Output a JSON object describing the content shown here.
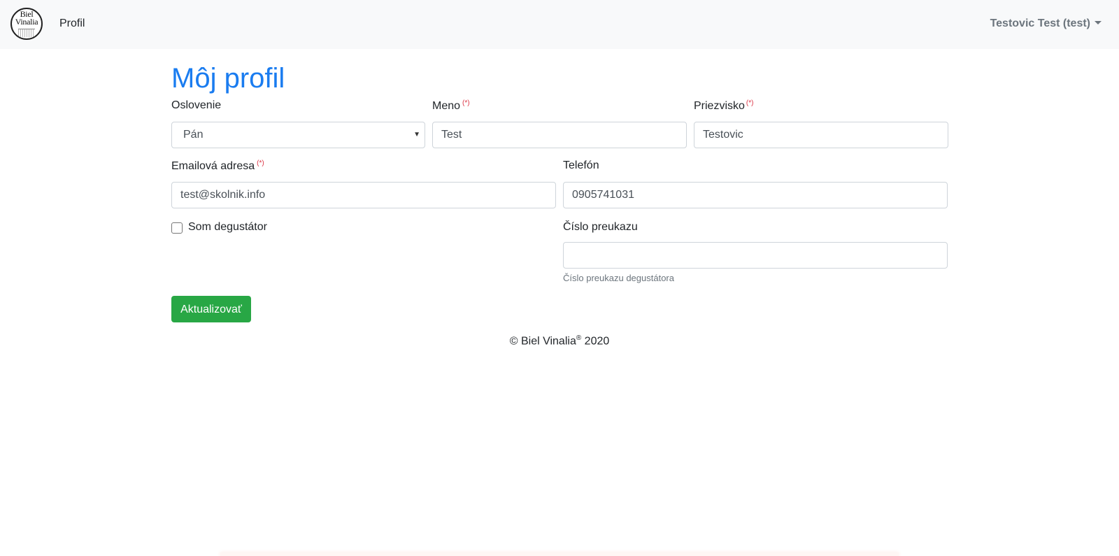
{
  "navbar": {
    "logo_text_line1": "Biel",
    "logo_text_line2": "Vinalia",
    "profile_link": "Profil",
    "user_menu": "Testovic Test (test)"
  },
  "page": {
    "title": "Môj profil"
  },
  "form": {
    "salutation": {
      "label": "Oslovenie",
      "value": "Pán"
    },
    "first_name": {
      "label": "Meno",
      "required_mark": "(*)",
      "value": "Test"
    },
    "last_name": {
      "label": "Priezvisko",
      "required_mark": "(*)",
      "value": "Testovic"
    },
    "email": {
      "label": "Emailová adresa",
      "required_mark": "(*)",
      "value": "test@skolnik.info"
    },
    "phone": {
      "label": "Telefón",
      "value": "0905741031"
    },
    "taster_checkbox": {
      "label": "Som degustátor",
      "checked": false
    },
    "card_number": {
      "label": "Číslo preukazu",
      "value": "",
      "help": "Číslo preukazu degustátora"
    },
    "submit_label": "Aktualizovať"
  },
  "footer": {
    "prefix": "© Biel Vinalia",
    "registered": "®",
    "year": " 2020"
  },
  "colors": {
    "title": "#1a7cf0",
    "submit": "#28a745",
    "required": "#dc3545",
    "navbar_bg": "#f8f9fa"
  }
}
